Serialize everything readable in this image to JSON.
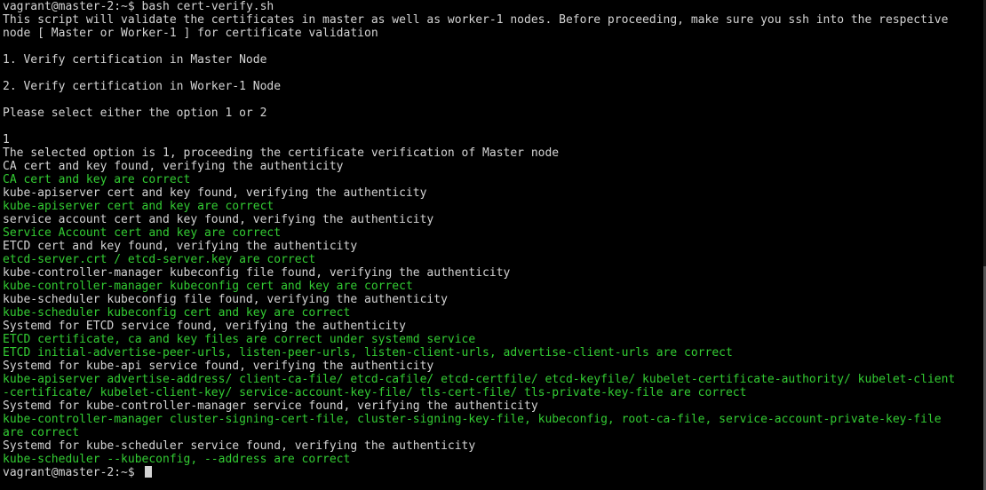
{
  "terminal": {
    "prompt": "vagrant@master-2:~$ ",
    "command": "bash cert-verify.sh",
    "lines": [
      {
        "text": "This script will validate the certificates in master as well as worker-1 nodes. Before proceeding, make sure you ssh into the respective",
        "color": "white"
      },
      {
        "text": "node [ Master or Worker-1 ] for certificate validation",
        "color": "white"
      },
      {
        "text": "",
        "color": "white"
      },
      {
        "text": "1. Verify certification in Master Node",
        "color": "white"
      },
      {
        "text": "",
        "color": "white"
      },
      {
        "text": "2. Verify certification in Worker-1 Node",
        "color": "white"
      },
      {
        "text": "",
        "color": "white"
      },
      {
        "text": "Please select either the option 1 or 2",
        "color": "white"
      },
      {
        "text": "",
        "color": "white"
      },
      {
        "text": "1",
        "color": "white"
      },
      {
        "text": "The selected option is 1, proceeding the certificate verification of Master node",
        "color": "white"
      },
      {
        "text": "CA cert and key found, verifying the authenticity",
        "color": "white"
      },
      {
        "text": "CA cert and key are correct",
        "color": "green"
      },
      {
        "text": "kube-apiserver cert and key found, verifying the authenticity",
        "color": "white"
      },
      {
        "text": "kube-apiserver cert and key are correct",
        "color": "green"
      },
      {
        "text": "service account cert and key found, verifying the authenticity",
        "color": "white"
      },
      {
        "text": "Service Account cert and key are correct",
        "color": "green"
      },
      {
        "text": "ETCD cert and key found, verifying the authenticity",
        "color": "white"
      },
      {
        "text": "etcd-server.crt / etcd-server.key are correct",
        "color": "green"
      },
      {
        "text": "kube-controller-manager kubeconfig file found, verifying the authenticity",
        "color": "white"
      },
      {
        "text": "kube-controller-manager kubeconfig cert and key are correct",
        "color": "green"
      },
      {
        "text": "kube-scheduler kubeconfig file found, verifying the authenticity",
        "color": "white"
      },
      {
        "text": "kube-scheduler kubeconfig cert and key are correct",
        "color": "green"
      },
      {
        "text": "Systemd for ETCD service found, verifying the authenticity",
        "color": "white"
      },
      {
        "text": "ETCD certificate, ca and key files are correct under systemd service",
        "color": "green"
      },
      {
        "text": "ETCD initial-advertise-peer-urls, listen-peer-urls, listen-client-urls, advertise-client-urls are correct",
        "color": "green"
      },
      {
        "text": "Systemd for kube-api service found, verifying the authenticity",
        "color": "white"
      },
      {
        "text": "kube-apiserver advertise-address/ client-ca-file/ etcd-cafile/ etcd-certfile/ etcd-keyfile/ kubelet-certificate-authority/ kubelet-client",
        "color": "green"
      },
      {
        "text": "-certificate/ kubelet-client-key/ service-account-key-file/ tls-cert-file/ tls-private-key-file are correct",
        "color": "green"
      },
      {
        "text": "Systemd for kube-controller-manager service found, verifying the authenticity",
        "color": "white"
      },
      {
        "text": "kube-controller-manager cluster-signing-cert-file, cluster-signing-key-file, kubeconfig, root-ca-file, service-account-private-key-file",
        "color": "green"
      },
      {
        "text": "are correct",
        "color": "green"
      },
      {
        "text": "Systemd for kube-scheduler service found, verifying the authenticity",
        "color": "white"
      },
      {
        "text": "kube-scheduler --kubeconfig, --address are correct",
        "color": "green"
      }
    ],
    "final_prompt": "vagrant@master-2:~$ "
  },
  "colors": {
    "background": "#000000",
    "text": "#d4d4d4",
    "success": "#33cc33"
  }
}
